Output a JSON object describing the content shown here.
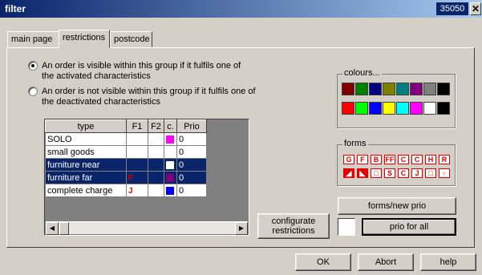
{
  "window": {
    "title": "filter",
    "code": "35050",
    "close": "✕"
  },
  "tabs": [
    {
      "label": "main page"
    },
    {
      "label": "restrictions"
    },
    {
      "label": "postcode"
    }
  ],
  "options": [
    {
      "text": "An order is visible within this group if it fulfils one of the activated characteristics",
      "selected": true
    },
    {
      "text": "An order is not visible within this group if it fulfils one of the deactivated characteristics",
      "selected": false
    }
  ],
  "grid": {
    "headers": [
      "type",
      "F1",
      "F2",
      "c.",
      "Prio"
    ],
    "rows": [
      {
        "type": "SOLO",
        "f1": "",
        "f2": "",
        "color": "#ff00ff",
        "prio": "0",
        "selected": false
      },
      {
        "type": "small goods",
        "f1": "",
        "f2": "",
        "color": "",
        "prio": "0",
        "selected": false
      },
      {
        "type": "furniture near",
        "f1": "",
        "f2": "",
        "color": "#ffffff",
        "prio": "0",
        "selected": true
      },
      {
        "type": "furniture far",
        "f1": "F",
        "f2": "",
        "color": "#800080",
        "prio": "0",
        "selected": true
      },
      {
        "type": "complete charge",
        "f1": "J",
        "f2": "",
        "color": "#0000ff",
        "prio": "0",
        "selected": false
      }
    ]
  },
  "colours": {
    "label": "colours...",
    "row1": [
      "#800000",
      "#008000",
      "#000080",
      "#808000",
      "#008080",
      "#800080",
      "#808080",
      "#000000"
    ],
    "row2": [
      "#ff0000",
      "#00ff00",
      "#0000ff",
      "#ffff00",
      "#00ffff",
      "#ff00ff",
      "#ffffff",
      "#000000"
    ]
  },
  "forms": {
    "label": "forms",
    "row1": [
      "G",
      "F",
      "B",
      "FF",
      "C",
      "C",
      "H",
      "R"
    ],
    "row2": [
      "◢",
      "◣",
      "□",
      "S",
      "C",
      "J",
      "□",
      "▫"
    ]
  },
  "buttons": {
    "configurate": "configurate restrictions",
    "forms_new_prio": "forms/new prio",
    "prio_for_all": "prio for all",
    "ok": "OK",
    "abort": "Abort",
    "help": "help"
  }
}
